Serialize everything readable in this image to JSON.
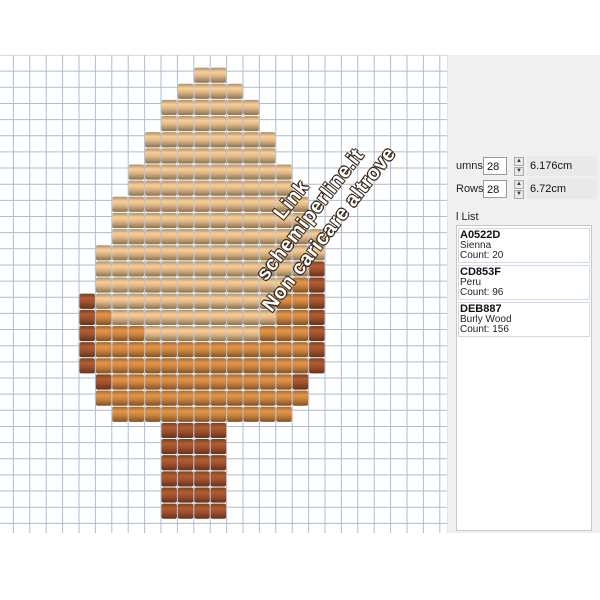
{
  "grid": {
    "columns": 28,
    "rows": 28,
    "bead_rows": [
      {
        "row": 0,
        "start": 12,
        "colors": [
          "burlywood",
          "burlywood"
        ]
      },
      {
        "row": 1,
        "start": 11,
        "colors": [
          "burlywood",
          "burlywood",
          "burlywood",
          "burlywood"
        ]
      },
      {
        "row": 2,
        "start": 10,
        "colors": [
          "burlywood",
          "burlywood",
          "burlywood",
          "burlywood",
          "burlywood",
          "burlywood"
        ]
      },
      {
        "row": 3,
        "start": 10,
        "colors": [
          "burlywood",
          "burlywood",
          "burlywood",
          "burlywood",
          "burlywood",
          "burlywood"
        ]
      },
      {
        "row": 4,
        "start": 9,
        "colors": [
          "burlywood",
          "burlywood",
          "burlywood",
          "burlywood",
          "burlywood",
          "burlywood",
          "burlywood",
          "burlywood"
        ]
      },
      {
        "row": 5,
        "start": 9,
        "colors": [
          "burlywood",
          "burlywood",
          "burlywood",
          "burlywood",
          "burlywood",
          "burlywood",
          "burlywood",
          "burlywood"
        ]
      },
      {
        "row": 6,
        "start": 8,
        "colors": [
          "burlywood",
          "burlywood",
          "burlywood",
          "burlywood",
          "burlywood",
          "burlywood",
          "burlywood",
          "burlywood",
          "burlywood",
          "burlywood"
        ]
      },
      {
        "row": 7,
        "start": 8,
        "colors": [
          "burlywood",
          "burlywood",
          "burlywood",
          "burlywood",
          "burlywood",
          "burlywood",
          "burlywood",
          "burlywood",
          "burlywood",
          "burlywood"
        ]
      },
      {
        "row": 8,
        "start": 7,
        "colors": [
          "burlywood",
          "burlywood",
          "burlywood",
          "burlywood",
          "burlywood",
          "burlywood",
          "burlywood",
          "burlywood",
          "burlywood",
          "burlywood",
          "burlywood",
          "burlywood"
        ]
      },
      {
        "row": 9,
        "start": 7,
        "colors": [
          "burlywood",
          "burlywood",
          "burlywood",
          "burlywood",
          "burlywood",
          "burlywood",
          "burlywood",
          "burlywood",
          "burlywood",
          "burlywood",
          "burlywood",
          "burlywood"
        ]
      },
      {
        "row": 10,
        "start": 7,
        "colors": [
          "burlywood",
          "burlywood",
          "burlywood",
          "burlywood",
          "burlywood",
          "burlywood",
          "burlywood",
          "burlywood",
          "burlywood",
          "burlywood",
          "burlywood",
          "burlywood",
          "burlywood"
        ]
      },
      {
        "row": 11,
        "start": 6,
        "colors": [
          "burlywood",
          "burlywood",
          "burlywood",
          "burlywood",
          "burlywood",
          "burlywood",
          "burlywood",
          "burlywood",
          "burlywood",
          "burlywood",
          "burlywood",
          "burlywood",
          "burlywood",
          "burlywood"
        ]
      },
      {
        "row": 12,
        "start": 6,
        "colors": [
          "burlywood",
          "burlywood",
          "burlywood",
          "burlywood",
          "burlywood",
          "burlywood",
          "burlywood",
          "burlywood",
          "burlywood",
          "burlywood",
          "burlywood",
          "burlywood",
          "burlywood",
          "sienna"
        ]
      },
      {
        "row": 13,
        "start": 6,
        "colors": [
          "burlywood",
          "burlywood",
          "burlywood",
          "burlywood",
          "burlywood",
          "burlywood",
          "burlywood",
          "burlywood",
          "burlywood",
          "burlywood",
          "burlywood",
          "burlywood",
          "peru",
          "sienna"
        ]
      },
      {
        "row": 14,
        "start": 5,
        "colors": [
          "sienna",
          "burlywood",
          "burlywood",
          "burlywood",
          "burlywood",
          "burlywood",
          "burlywood",
          "burlywood",
          "burlywood",
          "burlywood",
          "burlywood",
          "burlywood",
          "peru",
          "peru",
          "sienna"
        ]
      },
      {
        "row": 15,
        "start": 5,
        "colors": [
          "sienna",
          "peru",
          "burlywood",
          "burlywood",
          "burlywood",
          "burlywood",
          "burlywood",
          "burlywood",
          "burlywood",
          "burlywood",
          "burlywood",
          "burlywood",
          "peru",
          "peru",
          "sienna"
        ]
      },
      {
        "row": 16,
        "start": 5,
        "colors": [
          "sienna",
          "peru",
          "peru",
          "peru",
          "burlywood",
          "burlywood",
          "burlywood",
          "burlywood",
          "burlywood",
          "burlywood",
          "burlywood",
          "peru",
          "peru",
          "peru",
          "sienna"
        ]
      },
      {
        "row": 17,
        "start": 5,
        "colors": [
          "sienna",
          "peru",
          "peru",
          "peru",
          "peru",
          "peru",
          "peru",
          "peru",
          "peru",
          "peru",
          "peru",
          "peru",
          "peru",
          "peru",
          "sienna"
        ]
      },
      {
        "row": 18,
        "start": 5,
        "colors": [
          "sienna",
          "peru",
          "peru",
          "peru",
          "peru",
          "peru",
          "peru",
          "peru",
          "peru",
          "peru",
          "peru",
          "peru",
          "peru",
          "peru",
          "sienna"
        ]
      },
      {
        "row": 19,
        "start": 6,
        "colors": [
          "sienna",
          "peru",
          "peru",
          "peru",
          "peru",
          "peru",
          "peru",
          "peru",
          "peru",
          "peru",
          "peru",
          "peru",
          "sienna"
        ]
      },
      {
        "row": 20,
        "start": 6,
        "colors": [
          "peru",
          "peru",
          "peru",
          "peru",
          "peru",
          "peru",
          "peru",
          "peru",
          "peru",
          "peru",
          "peru",
          "peru",
          "peru"
        ]
      },
      {
        "row": 21,
        "start": 7,
        "colors": [
          "peru",
          "peru",
          "peru",
          "peru",
          "peru",
          "peru",
          "peru",
          "peru",
          "peru",
          "peru",
          "peru"
        ]
      },
      {
        "row": 22,
        "start": 10,
        "colors": [
          "sienna",
          "sienna",
          "sienna",
          "sienna"
        ]
      },
      {
        "row": 23,
        "start": 10,
        "colors": [
          "sienna",
          "sienna",
          "sienna",
          "sienna"
        ]
      },
      {
        "row": 24,
        "start": 10,
        "colors": [
          "sienna",
          "sienna",
          "sienna",
          "sienna"
        ]
      },
      {
        "row": 25,
        "start": 10,
        "colors": [
          "sienna",
          "sienna",
          "sienna",
          "sienna"
        ]
      },
      {
        "row": 26,
        "start": 10,
        "colors": [
          "sienna",
          "sienna",
          "sienna",
          "sienna"
        ]
      },
      {
        "row": 27,
        "start": 10,
        "colors": [
          "sienna",
          "sienna",
          "sienna",
          "sienna"
        ]
      }
    ]
  },
  "bead_colors": {
    "burlywood": "#DEB887",
    "peru": "#CD853F",
    "sienna": "#A0522D",
    "grid_line": "#A9BED3"
  },
  "watermark": {
    "line1": "Link",
    "line2": "schemiperline.it",
    "line3": "Non caricare altrove"
  },
  "dimensions": {
    "columns_label": "umns",
    "columns_value": "28",
    "columns_measure": "6.176cm",
    "rows_label": "Rows",
    "rows_value": "28",
    "rows_measure": "6.72cm"
  },
  "color_list": {
    "title": "l List",
    "items": [
      {
        "code": "A0522D",
        "name": "Sienna",
        "count": "Count: 20",
        "hex": "#A0522D"
      },
      {
        "code": "CD853F",
        "name": "Peru",
        "count": "Count: 96",
        "hex": "#CD853F"
      },
      {
        "code": "DEB887",
        "name": "Burly Wood",
        "count": "Count: 156",
        "hex": "#DEB887"
      }
    ]
  }
}
